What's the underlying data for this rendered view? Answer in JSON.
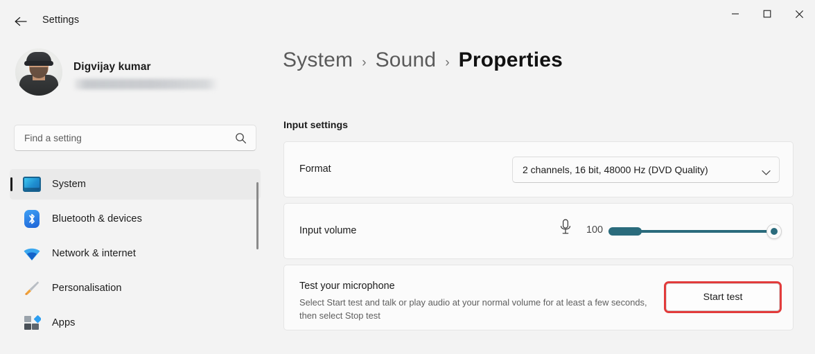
{
  "window": {
    "app_title": "Settings",
    "back_icon": "back-arrow-icon",
    "controls": {
      "minimize": "minimize-icon",
      "maximize": "maximize-icon",
      "close": "close-icon"
    }
  },
  "sidebar": {
    "profile": {
      "name": "Digvijay kumar",
      "email_masked": ""
    },
    "search": {
      "placeholder": "Find a setting",
      "value": "",
      "icon": "search-icon"
    },
    "items": [
      {
        "label": "System",
        "icon": "monitor-icon",
        "selected": true
      },
      {
        "label": "Bluetooth & devices",
        "icon": "bluetooth-icon",
        "selected": false
      },
      {
        "label": "Network & internet",
        "icon": "wifi-icon",
        "selected": false
      },
      {
        "label": "Personalisation",
        "icon": "paintbrush-icon",
        "selected": false
      },
      {
        "label": "Apps",
        "icon": "apps-icon",
        "selected": false
      }
    ]
  },
  "content": {
    "breadcrumb": {
      "items": [
        "System",
        "Sound"
      ],
      "current": "Properties",
      "separator": "›"
    },
    "section_title": "Input settings",
    "format": {
      "label": "Format",
      "selected_option": "2 channels, 16 bit, 48000 Hz (DVD Quality)",
      "chevron": "chevron-down-icon"
    },
    "input_volume": {
      "label": "Input volume",
      "mic_icon": "microphone-icon",
      "value": "100",
      "min": 0,
      "max": 100,
      "level_meter_percent": 20
    },
    "test_microphone": {
      "title": "Test your microphone",
      "description": "Select Start test and talk or play audio at your normal volume for at least a few seconds, then select Stop test",
      "button_label": "Start test",
      "highlight_color": "#e23b3b"
    }
  },
  "theme": {
    "page_background": "#f3f3f3",
    "card_background": "#fbfbfb",
    "accent": "#2a6b7c",
    "text_primary": "#1b1b1b",
    "text_secondary": "#5e5e5e"
  }
}
